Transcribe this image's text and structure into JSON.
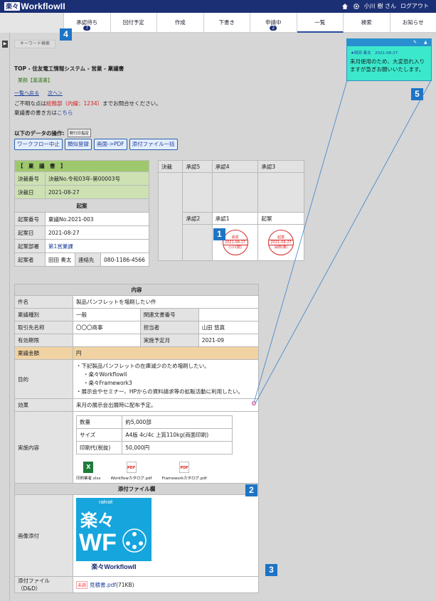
{
  "header": {
    "logo_mark": "楽々",
    "logo_text": "WorkflowII",
    "user": "小川 樹 さん",
    "logout": "ログアウト"
  },
  "nav": {
    "tabs": [
      {
        "label": "承認待ち",
        "badge": "7"
      },
      {
        "label": "回付予定",
        "badge": ""
      },
      {
        "label": "作成",
        "badge": ""
      },
      {
        "label": "下書き",
        "badge": ""
      },
      {
        "label": "申請中",
        "badge": "2"
      },
      {
        "label": "一覧",
        "badge": ""
      },
      {
        "label": "検索",
        "badge": ""
      },
      {
        "label": "お知らせ",
        "badge": ""
      }
    ]
  },
  "keyword_search": "キーワード検索",
  "callouts": {
    "c1": "1",
    "c2": "2",
    "c3": "3",
    "c4": "4",
    "c5": "5"
  },
  "breadcrumb": "TOP - 住友電工情報システム - 営業 - 稟議書",
  "subtitle": "業務【稟議書】",
  "links": {
    "prev": "一覧へ戻る",
    "next": "次へ＞"
  },
  "notes": {
    "contact_prefix": "ご不明な点は",
    "contact_dept": "総務部（内線：1234）",
    "contact_suffix": "までお問合せください。",
    "howto_prefix": "稟議書の書き方は",
    "howto_link": "こちら"
  },
  "ops": {
    "title": "以下のデータの操作:",
    "mini": "発行日指定"
  },
  "buttons": {
    "stop": "ワークフロー中止",
    "similar": "類似登録",
    "pdf": "画面->PDF",
    "attach": "添付ファイル一括"
  },
  "approval": {
    "title": "【　稟　議　書　】",
    "decision_no_label": "決裁番号",
    "decision_no": "決裁No.令和03年-第00003号",
    "decision_date_label": "決裁日",
    "decision_date": "2021-08-27",
    "draft_section": "起案",
    "draft_no_label": "起案番号",
    "draft_no": "稟議No.2021-003",
    "draft_date_label": "起案日",
    "draft_date": "2021-08-27",
    "draft_dept_label": "起案部署",
    "draft_dept": "第1営業課",
    "drafter_label": "起案者",
    "drafter": "田田 奏太",
    "contact_label": "連絡先",
    "contact": "080-1186-4566",
    "cols_top": [
      "決裁",
      "承認5",
      "承認4",
      "承認3"
    ],
    "cols_bottom": [
      "承認2",
      "承認1",
      "起案"
    ],
    "stamp1": {
      "title": "承認",
      "date": "2021-08-27",
      "name": "小川(樹)"
    },
    "stamp2": {
      "title": "起案",
      "date": "2021-08-27",
      "name": "岡田(奏)"
    }
  },
  "content": {
    "header": "内容",
    "rows": {
      "subject_label": "件名",
      "subject": "製品パンフレットを増刷したい件",
      "type_label": "稟議種別",
      "type": "一般",
      "related_label": "関連文書番号",
      "related": "",
      "client_label": "取引先名称",
      "client": "〇〇〇商事",
      "person_label": "担当者",
      "person": "山田 悠真",
      "period_label": "有効期限",
      "period": "",
      "schedule_label": "実施予定月",
      "schedule": "2021-09",
      "amount_label": "稟議金額",
      "amount": "円",
      "purpose_label": "目的",
      "purpose1": "・下記製品パンフレットの在庫減少のため増刷したい。",
      "purpose2": "・楽々WorkflowII",
      "purpose3": "・楽々Framework3",
      "purpose4": "・展示会やセミナー、HPからの資料請求等の拡販活動に利用したい。",
      "effect_label": "効果",
      "effect": "来月の展示会出展時に配布予定。",
      "impl_label": "実施内容"
    },
    "inner": [
      {
        "k": "数量",
        "v": "約5,000部"
      },
      {
        "k": "サイズ",
        "v": "A4版 4c/4c 上質110kg(両面印刷)"
      },
      {
        "k": "印刷代(税抜)",
        "v": "50,000円"
      }
    ],
    "files": [
      "印刷業者.xlsx",
      "Workflowカタログ.pdf",
      "Frameworkカタログ.pdf"
    ],
    "attach_header": "添付ファイル欄",
    "image_label": "画像添付",
    "dnd_label": "添付ファイル（D&D）",
    "unread": "未読",
    "dnd_file": "見積書.pdf",
    "dnd_size": "(71KB)"
  },
  "wf_image": {
    "kana": "楽々",
    "rak": "rakrak",
    "big": "WF",
    "foot": "楽々WorkflowII"
  },
  "sticky": {
    "meta": "★岡田 奏太　2021-08-27",
    "message": "来月使用のため、大変恐れ入りますが急ぎお願いいたします。"
  }
}
